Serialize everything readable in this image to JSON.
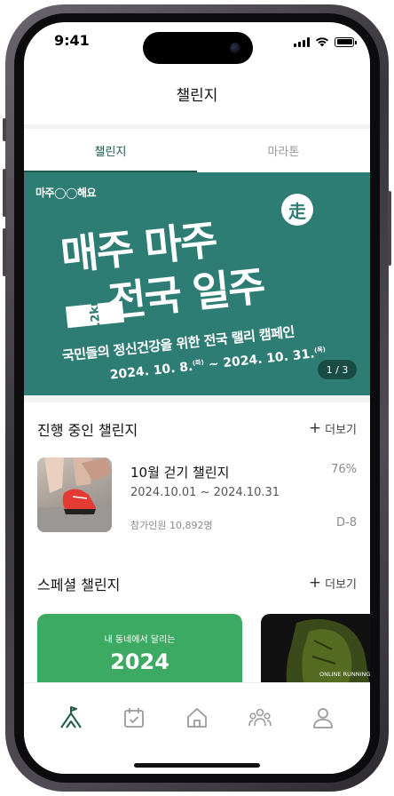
{
  "status_bar": {
    "time": "9:41"
  },
  "header": {
    "title": "챌린지"
  },
  "tabs": [
    {
      "label": "챌린지",
      "active": true
    },
    {
      "label": "마라톤",
      "active": false
    }
  ],
  "banner": {
    "logo_text_left": "마주",
    "logo_text_right": "해요",
    "badge": "走",
    "line1": "매주 마주",
    "line2": "전국 일주",
    "distance_tag": "2.2km",
    "subtitle": "국민들의 정신건강을 위한 전국 랠리 캠페인",
    "date_start": "2024. 10. 8.",
    "date_start_day": "(화)",
    "date_sep": " ~ ",
    "date_end": "2024. 10. 31.",
    "date_end_day": "(목)",
    "page_indicator": "1 / 3",
    "background_color": "#2e7d74"
  },
  "ongoing": {
    "title": "진행 중인 챌린지",
    "more_label": "더보기",
    "challenge": {
      "name": "10월 걷기 챌린지",
      "period": "2024.10.01 ~ 2024.10.31",
      "percent": "76%",
      "participants": "참가인원 10,892명",
      "dday": "D-8"
    }
  },
  "special": {
    "title": "스페셜 챌린지",
    "more_label": "더보기",
    "cards": [
      {
        "subtitle": "내 동네에서 달리는",
        "headline": "2024",
        "color": "#3daa63"
      },
      {
        "caption": "ONLINE RUNNING",
        "color": "#111111"
      }
    ]
  },
  "bottom_nav": {
    "items": [
      {
        "icon": "mountain-flag-icon",
        "active": true
      },
      {
        "icon": "calendar-check-icon",
        "active": false
      },
      {
        "icon": "home-icon",
        "active": false
      },
      {
        "icon": "group-icon",
        "active": false
      },
      {
        "icon": "profile-icon",
        "active": false
      }
    ],
    "active_color": "#1f5b4d",
    "inactive_color": "#9a9a9a"
  }
}
